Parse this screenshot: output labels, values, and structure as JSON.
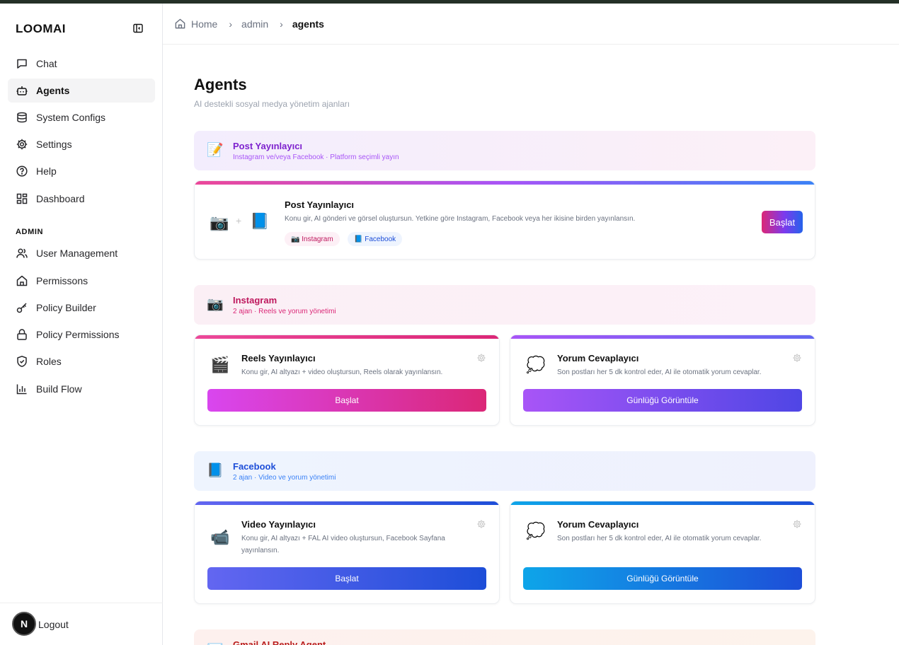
{
  "brand": "LOOMAI",
  "sidebar": {
    "items": [
      {
        "label": "Chat",
        "icon": "chat-icon"
      },
      {
        "label": "Agents",
        "icon": "bot-icon",
        "active": true
      },
      {
        "label": "System Configs",
        "icon": "database-icon"
      },
      {
        "label": "Settings",
        "icon": "gear-icon"
      },
      {
        "label": "Help",
        "icon": "help-circle-icon"
      },
      {
        "label": "Dashboard",
        "icon": "dashboard-icon"
      }
    ],
    "admin_label": "ADMIN",
    "admin_items": [
      {
        "label": "User Management",
        "icon": "users-icon"
      },
      {
        "label": "Permissons",
        "icon": "home-icon"
      },
      {
        "label": "Policy Builder",
        "icon": "key-icon"
      },
      {
        "label": "Policy Permissions",
        "icon": "lock-icon"
      },
      {
        "label": "Roles",
        "icon": "shield-icon"
      },
      {
        "label": "Build Flow",
        "icon": "bar-chart-icon"
      }
    ],
    "avatar_letter": "N",
    "logout": "Logout"
  },
  "breadcrumb": {
    "home": "Home",
    "sep1": "›",
    "admin": "admin",
    "sep2": "›",
    "current": "agents"
  },
  "page": {
    "title": "Agents",
    "subtitle": "AI destekli sosyal medya yönetim ajanları"
  },
  "groups": {
    "post": {
      "icon": "📝",
      "title": "Post Yayınlayıcı",
      "subtitle": "Instagram ve/veya Facebook · Platform seçimli yayın",
      "card": {
        "icon_left": "📷",
        "plus": "+",
        "icon_right": "📘",
        "title": "Post Yayınlayıcı",
        "desc": "Konu gir, AI gönderi ve görsel oluştursun. Yetkine göre Instagram, Facebook veya her ikisine birden yayınlansın.",
        "tag1": "📷 Instagram",
        "tag2": "📘 Facebook",
        "button": "Başlat"
      }
    },
    "instagram": {
      "icon": "📷",
      "title": "Instagram",
      "subtitle": "2 ajan · Reels ve yorum yönetimi",
      "cards": [
        {
          "icon": "🎬",
          "title": "Reels Yayınlayıcı",
          "desc": "Konu gir, AI altyazı + video oluştursun, Reels olarak yayınlansın.",
          "button": "Başlat"
        },
        {
          "icon": "💭",
          "title": "Yorum Cevaplayıcı",
          "desc": "Son postları her 5 dk kontrol eder, AI ile otomatik yorum cevaplar.",
          "button": "Günlüğü Görüntüle"
        }
      ]
    },
    "facebook": {
      "icon": "📘",
      "title": "Facebook",
      "subtitle": "2 ajan · Video ve yorum yönetimi",
      "cards": [
        {
          "icon": "📹",
          "title": "Video Yayınlayıcı",
          "desc": "Konu gir, AI altyazı + FAL AI video oluştursun, Facebook Sayfana yayınlansın.",
          "button": "Başlat"
        },
        {
          "icon": "💭",
          "title": "Yorum Cevaplayıcı",
          "desc": "Son postları her 5 dk kontrol eder, AI ile otomatik yorum cevaplar.",
          "button": "Günlüğü Görüntüle"
        }
      ]
    },
    "gmail": {
      "icon": "📧",
      "title": "Gmail AI Reply Agent"
    }
  },
  "colors": {
    "post_title": "#7e22ce",
    "instagram_title": "#be185d",
    "facebook_title": "#1d4ed8",
    "gmail_title": "#b91c1c"
  }
}
